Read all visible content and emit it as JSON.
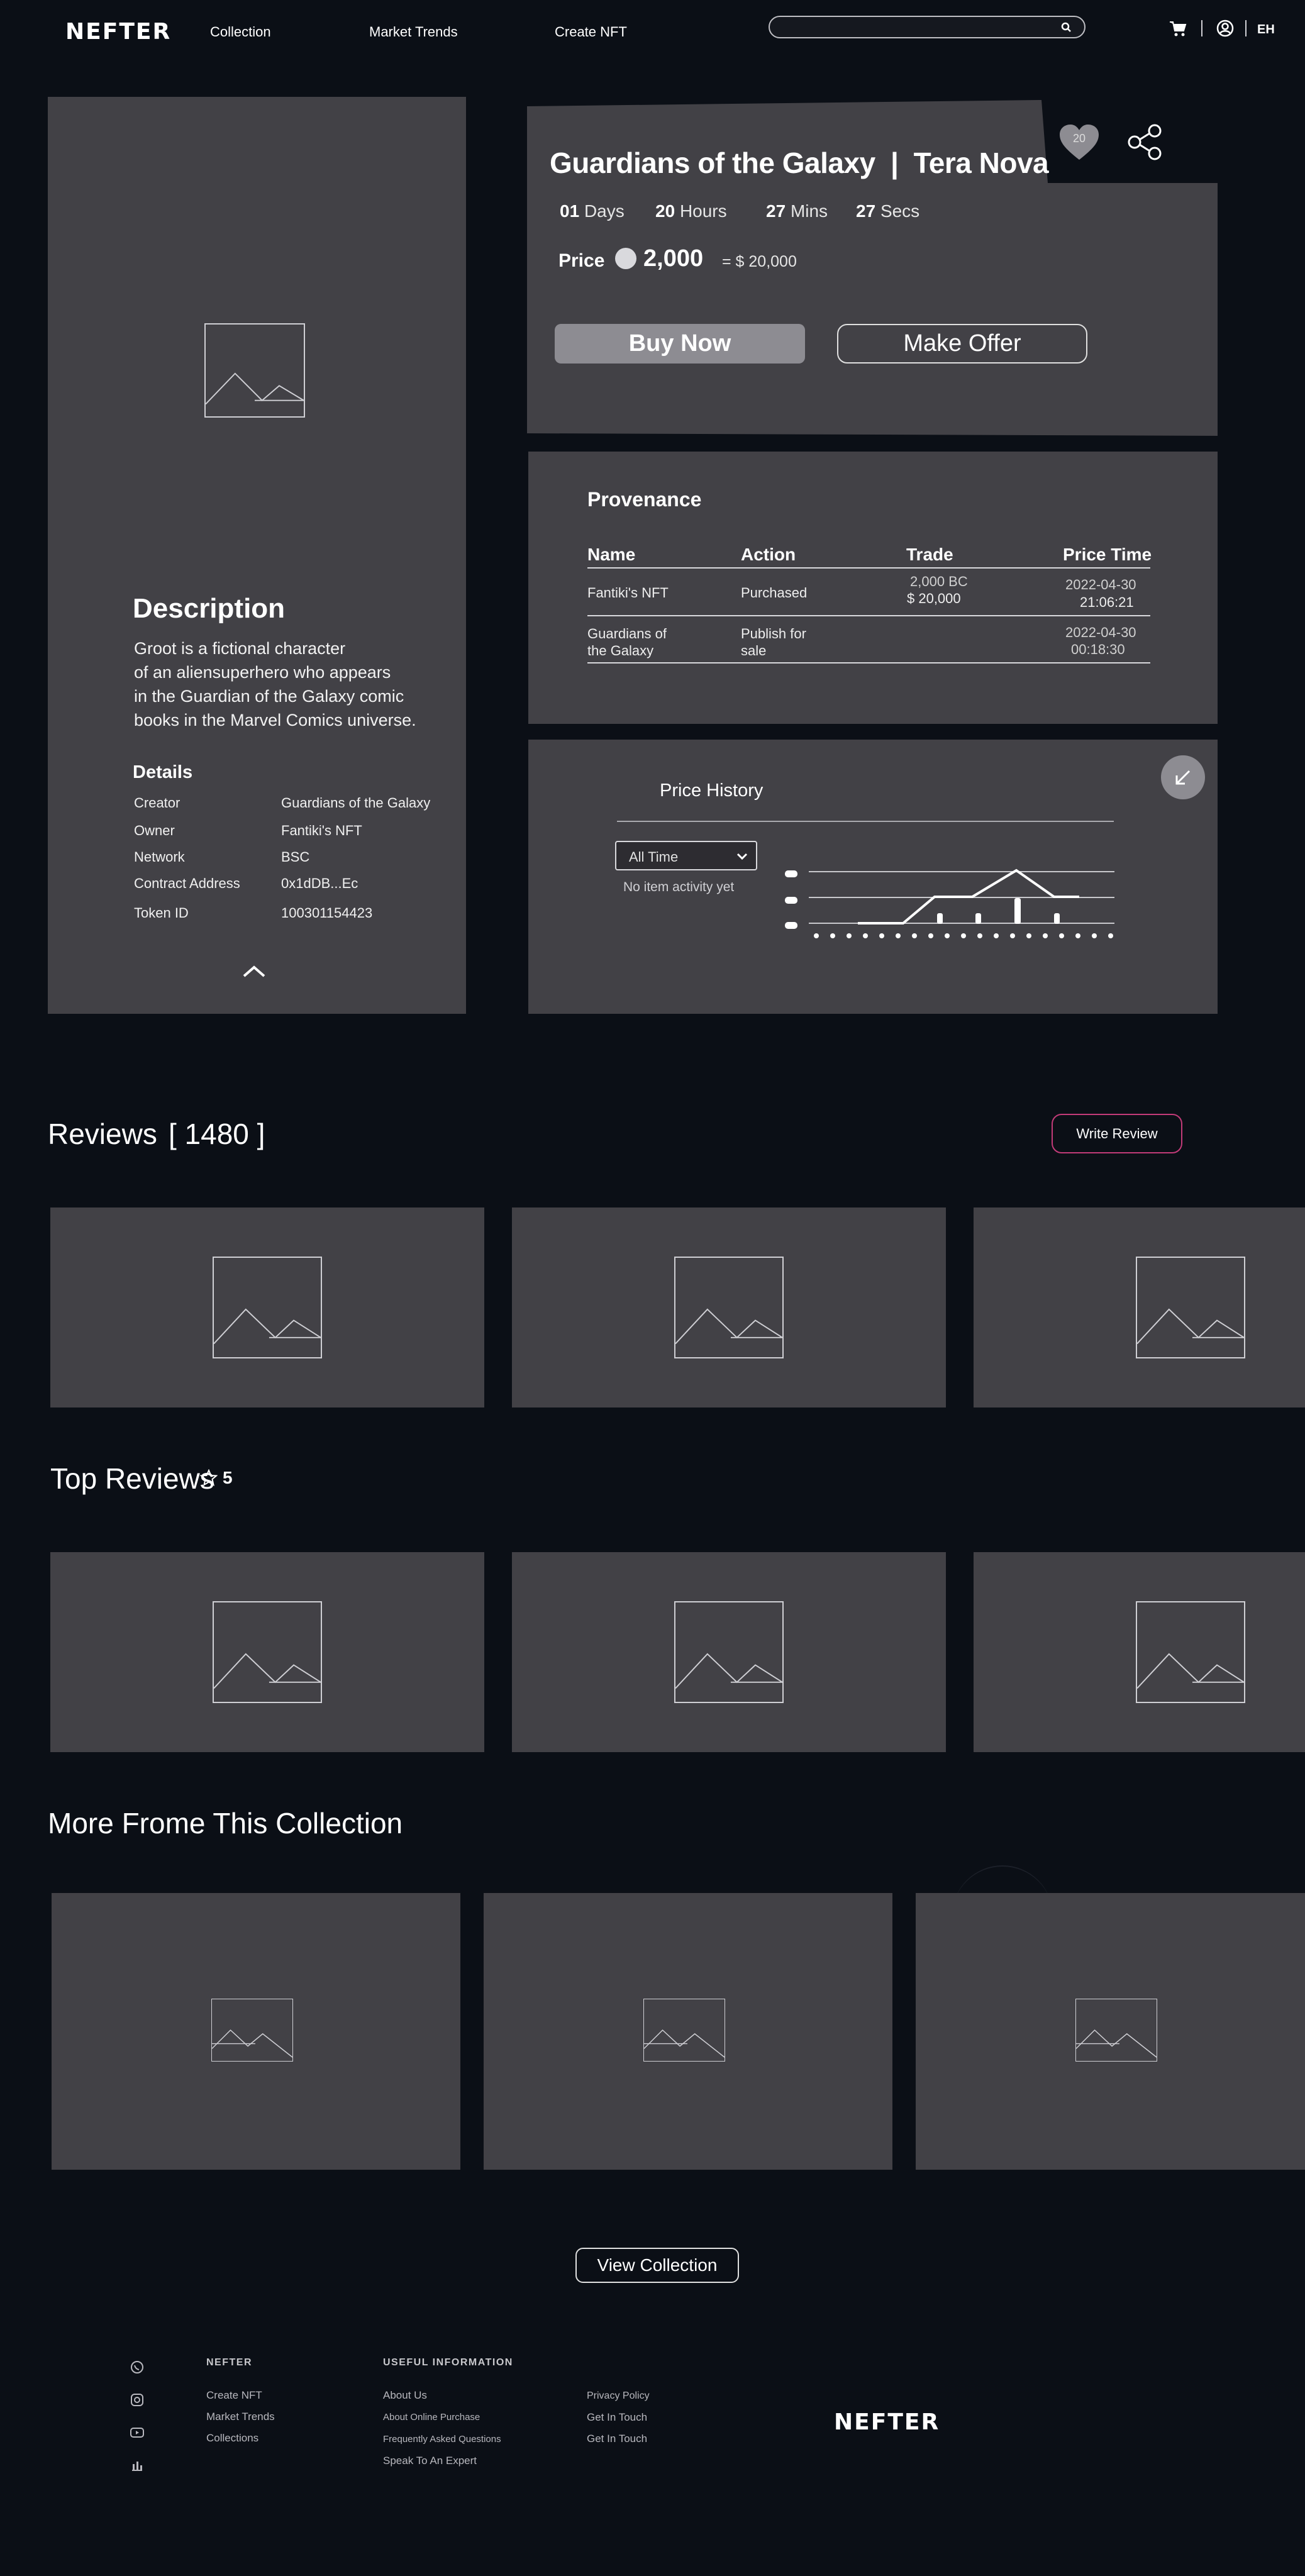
{
  "nav": {
    "logo": "NEFTER",
    "links": [
      "Collection",
      "Market Trends",
      "Create NFT"
    ],
    "search_placeholder": "",
    "lang": "EH"
  },
  "product": {
    "title": "Guardians of the Galaxy",
    "separator": "|",
    "subtitle": "Tera Nova",
    "likes": "20",
    "timer": {
      "days": "01",
      "days_label": "Days",
      "hours": "20",
      "hours_label": "Hours",
      "mins": "27",
      "mins_label": "Mins",
      "secs": "27",
      "secs_label": "Secs"
    },
    "price_label": "Price",
    "price_value": "2,000",
    "price_usd": "= $ 20,000",
    "buy_label": "Buy Now",
    "offer_label": "Make Offer"
  },
  "description": {
    "heading": "Description",
    "lines": [
      "Groot is a fictional character",
      "of an aliensuperhero who appears",
      "in the Guardian of the Galaxy comic",
      "books in the Marvel Comics universe."
    ]
  },
  "details": {
    "heading": "Details",
    "rows": [
      {
        "key": "Creator",
        "value": "Guardians of the Galaxy"
      },
      {
        "key": "Owner",
        "value": "Fantiki's  NFT"
      },
      {
        "key": "Network",
        "value": "BSC"
      },
      {
        "key": "Contract Address",
        "value": "0x1dDB...Ec"
      },
      {
        "key": "Token ID",
        "value": "100301154423"
      }
    ]
  },
  "provenance": {
    "heading": "Provenance",
    "columns": [
      "Name",
      "Action",
      "Trade",
      "Price Time"
    ],
    "rows": [
      {
        "name": [
          "Fantiki's  NFT"
        ],
        "action": [
          "Purchased"
        ],
        "trade": [
          "2,000 BC",
          "$ 20,000"
        ],
        "time": [
          "2022-04-30",
          "21:06:21"
        ]
      },
      {
        "name": [
          "Guardians of",
          "the Galaxy"
        ],
        "action": [
          "Publish for",
          "sale"
        ],
        "trade": [],
        "time": [
          "2022-04-30",
          "00:18:30"
        ]
      }
    ]
  },
  "price_history": {
    "heading": "Price History",
    "filter": "All Time",
    "empty": "No item activity yet"
  },
  "reviews": {
    "heading": "Reviews",
    "count": "[ 1480 ]",
    "write_label": "Write Review"
  },
  "top_reviews": {
    "heading": "Top Reviews",
    "rating": "5"
  },
  "more": {
    "heading": "More Frome This Collection",
    "view_label": "View Collection"
  },
  "footer": {
    "col1": {
      "heading": "NEFTER",
      "links": [
        "Create NFT",
        "Market Trends",
        "Collections"
      ]
    },
    "col2": {
      "heading": "USEFUL INFORMATION",
      "links": [
        "About Us",
        "About Online Purchase",
        "Frequently Asked Questions",
        "Speak To An Expert"
      ]
    },
    "col3": {
      "links": [
        "Privacy Policy",
        "Get In Touch",
        "Get In Touch"
      ]
    },
    "logo": "NEFTER"
  }
}
